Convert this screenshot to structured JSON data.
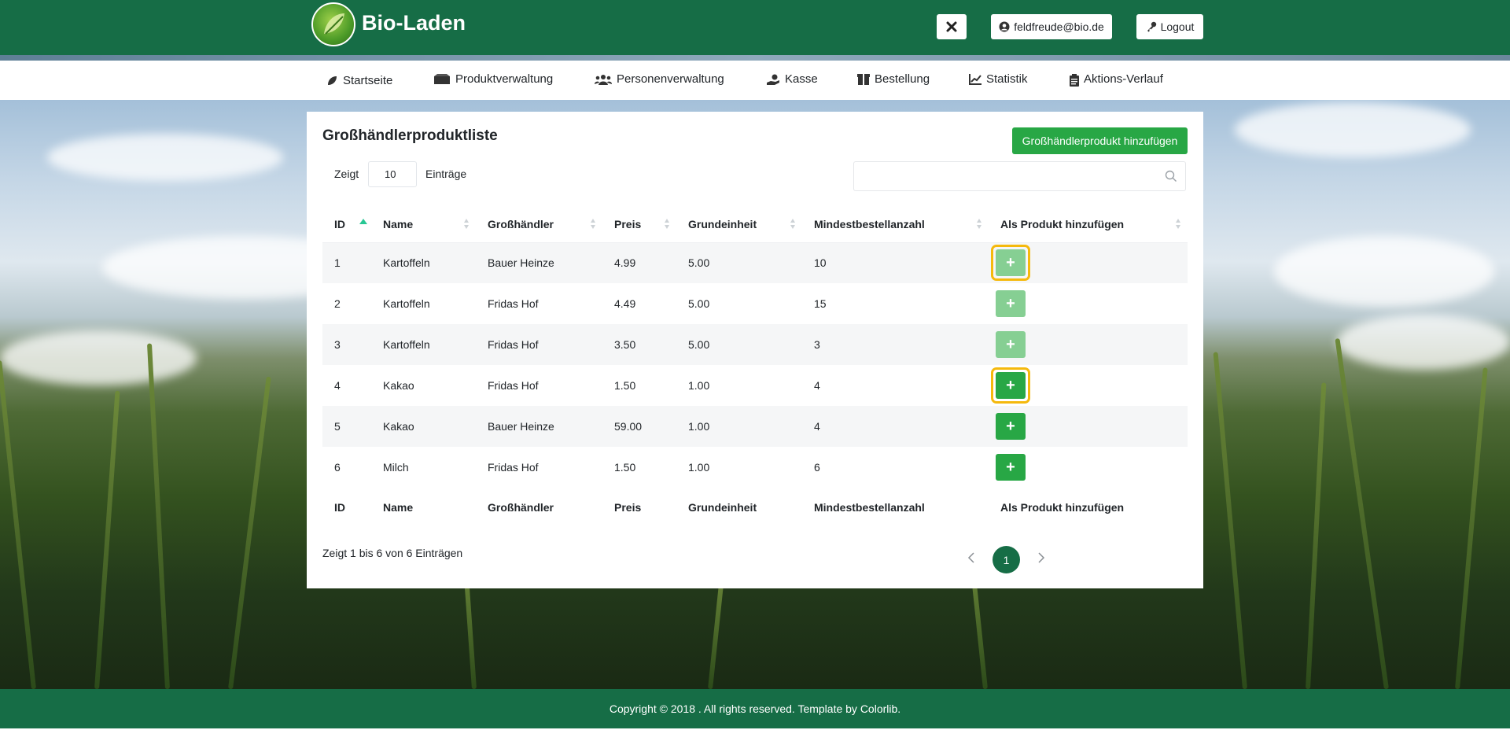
{
  "brand": {
    "name": "Bio-Laden"
  },
  "header": {
    "user_email": "feldfreude@bio.de",
    "logout_label": "Logout"
  },
  "nav": [
    {
      "label": "Startseite",
      "icon": "leaf-icon"
    },
    {
      "label": "Produktverwaltung",
      "icon": "boxes-icon"
    },
    {
      "label": "Personenverwaltung",
      "icon": "users-icon"
    },
    {
      "label": "Kasse",
      "icon": "hand-coin-icon"
    },
    {
      "label": "Bestellung",
      "icon": "box-icon"
    },
    {
      "label": "Statistik",
      "icon": "chart-line-icon"
    },
    {
      "label": "Aktions-Verlauf",
      "icon": "clipboard-icon"
    }
  ],
  "card": {
    "title": "Großhändlerproduktliste",
    "add_button": "Großhändlerprodukt hinzufügen",
    "length_prefix": "Zeigt",
    "length_value": "10",
    "length_suffix": "Einträge",
    "info": "Zeigt 1 bis 6 von 6 Einträgen",
    "page": "1"
  },
  "table": {
    "columns": [
      "ID",
      "Name",
      "Großhändler",
      "Preis",
      "Grundeinheit",
      "Mindestbestellanzahl",
      "Als Produkt hinzufügen"
    ],
    "rows": [
      {
        "id": "1",
        "name": "Kartoffeln",
        "dealer": "Bauer Heinze",
        "price": "4.99",
        "unit": "5.00",
        "min": "10",
        "action": "+"
      },
      {
        "id": "2",
        "name": "Kartoffeln",
        "dealer": "Fridas Hof",
        "price": "4.49",
        "unit": "5.00",
        "min": "15",
        "action": "+"
      },
      {
        "id": "3",
        "name": "Kartoffeln",
        "dealer": "Fridas Hof",
        "price": "3.50",
        "unit": "5.00",
        "min": "3",
        "action": "+"
      },
      {
        "id": "4",
        "name": "Kakao",
        "dealer": "Fridas Hof",
        "price": "1.50",
        "unit": "1.00",
        "min": "4",
        "action": "+"
      },
      {
        "id": "5",
        "name": "Kakao",
        "dealer": "Bauer Heinze",
        "price": "59.00",
        "unit": "1.00",
        "min": "4",
        "action": "+"
      },
      {
        "id": "6",
        "name": "Milch",
        "dealer": "Fridas Hof",
        "price": "1.50",
        "unit": "1.00",
        "min": "6",
        "action": "+"
      }
    ]
  },
  "footer": {
    "text": "Copyright © 2018 . All rights reserved. Template by Colorlib."
  },
  "colors": {
    "brand_green": "#166d46",
    "button_green": "#28a745",
    "highlight": "#f5b90d"
  }
}
